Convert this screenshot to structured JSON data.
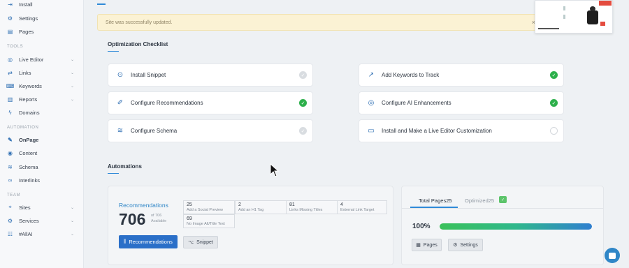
{
  "sidebar": {
    "items": [
      {
        "label": "Install",
        "icon": "install-icon",
        "glyph": "⇥"
      },
      {
        "label": "Settings",
        "icon": "gear-icon",
        "glyph": "⚙"
      },
      {
        "label": "Pages",
        "icon": "pages-icon",
        "glyph": "▤"
      },
      {
        "label": "Live Editor",
        "icon": "globe-icon",
        "glyph": "◎"
      },
      {
        "label": "Links",
        "icon": "links-icon",
        "glyph": "⇄"
      },
      {
        "label": "Keywords",
        "icon": "keywords-icon",
        "glyph": "⌨"
      },
      {
        "label": "Reports",
        "icon": "reports-icon",
        "glyph": "▥"
      },
      {
        "label": "Domains",
        "icon": "domains-icon",
        "glyph": "ϟ"
      },
      {
        "label": "OnPage",
        "icon": "onpage-icon",
        "glyph": "✎"
      },
      {
        "label": "Content",
        "icon": "content-icon",
        "glyph": "◉"
      },
      {
        "label": "Schema",
        "icon": "schema-icon",
        "glyph": "≋"
      },
      {
        "label": "Interlinks",
        "icon": "interlinks-icon",
        "glyph": "∞"
      },
      {
        "label": "Sites",
        "icon": "sites-icon",
        "glyph": "⌖"
      },
      {
        "label": "Services",
        "icon": "services-icon",
        "glyph": "⚙"
      },
      {
        "label": "#AllAI",
        "icon": "team-icon",
        "glyph": "☷"
      }
    ],
    "sections": {
      "tools": "TOOLS",
      "automation": "AUTOMATION",
      "team": "TEAM"
    }
  },
  "alert": {
    "message": "Site was successfully updated.",
    "close": "×"
  },
  "checklist": {
    "title": "Optimization Checklist",
    "items": [
      {
        "label": "Install Snippet",
        "icon": "snippet-icon",
        "glyph": "⊙",
        "status": "pending"
      },
      {
        "label": "Add Keywords to Track",
        "icon": "trend-icon",
        "glyph": "↗",
        "status": "done"
      },
      {
        "label": "Configure Recommendations",
        "icon": "wand-icon",
        "glyph": "✐",
        "status": "done"
      },
      {
        "label": "Configure AI Enhancements",
        "icon": "fingerprint-icon",
        "glyph": "◎",
        "status": "done"
      },
      {
        "label": "Configure Schema",
        "icon": "layers-icon",
        "glyph": "≋",
        "status": "pending"
      },
      {
        "label": "Install and Make a Live Editor Customization",
        "icon": "browser-icon",
        "glyph": "▭",
        "status": "empty"
      }
    ]
  },
  "automations": {
    "title": "Automations",
    "recommendations": {
      "title": "Recommendations",
      "count": "706",
      "sub_line1": "of 706",
      "sub_line2": "Available",
      "grid": [
        {
          "n": "25",
          "l": "Add a Social Preview"
        },
        {
          "n": "2",
          "l": "Add an H1 Tag"
        },
        {
          "n": "81",
          "l": "Links Missing Titles"
        },
        {
          "n": "4",
          "l": "External Link Target"
        },
        {
          "n": "69",
          "l": "No Image Alt/Title Text"
        }
      ],
      "button": "Recommendations",
      "snippet_button": "Snippet"
    },
    "pages": {
      "tab_total": "Total Pages",
      "tab_total_count": "25",
      "tab_optimized": "Optimized",
      "tab_optimized_count": "25",
      "badge": "✓",
      "percent": "100%",
      "progress": 1.0,
      "pages_button": "Pages",
      "settings_button": "Settings"
    }
  },
  "colors": {
    "accent": "#2f86c7",
    "success": "#2db04b",
    "alert_bg": "#fbf2d4"
  }
}
